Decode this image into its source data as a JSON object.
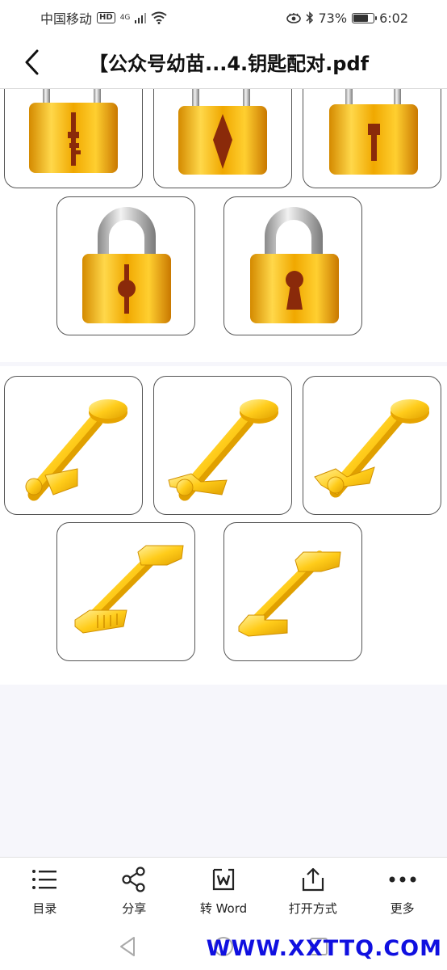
{
  "status_bar": {
    "carrier": "中国移动",
    "hd_badge": "HD",
    "signal_label": "4G",
    "battery_percent": "73%",
    "battery_level": 0.73,
    "time": "6:02"
  },
  "header": {
    "title": "【公众号幼苗...4.钥匙配对.pdf",
    "back_icon": "chevron-left-icon"
  },
  "document": {
    "locks": [
      {
        "name": "lock-1",
        "keyhole": "bit-key"
      },
      {
        "name": "lock-2",
        "keyhole": "diamond"
      },
      {
        "name": "lock-3",
        "keyhole": "t-bar"
      },
      {
        "name": "lock-4",
        "keyhole": "round-slot"
      },
      {
        "name": "lock-5",
        "keyhole": "keyhole"
      }
    ],
    "keys": [
      {
        "name": "key-1",
        "head": "round"
      },
      {
        "name": "key-2",
        "head": "round"
      },
      {
        "name": "key-3",
        "head": "round"
      },
      {
        "name": "key-4",
        "head": "t-bar"
      },
      {
        "name": "key-5",
        "head": "t-bar"
      }
    ]
  },
  "toolbar": {
    "items": [
      {
        "label": "目录",
        "icon": "list-icon"
      },
      {
        "label": "分享",
        "icon": "share-icon"
      },
      {
        "label": "转 Word",
        "icon": "word-convert-icon"
      },
      {
        "label": "打开方式",
        "icon": "open-with-icon"
      },
      {
        "label": "更多",
        "icon": "more-icon"
      }
    ]
  },
  "navbar": {
    "watermark": "WWW.XXTTQ.COM"
  },
  "colors": {
    "gold_light": "#ffd84a",
    "gold_dark": "#d48a00",
    "keyhole": "#8a2a0a",
    "watermark": "#1010e0"
  }
}
